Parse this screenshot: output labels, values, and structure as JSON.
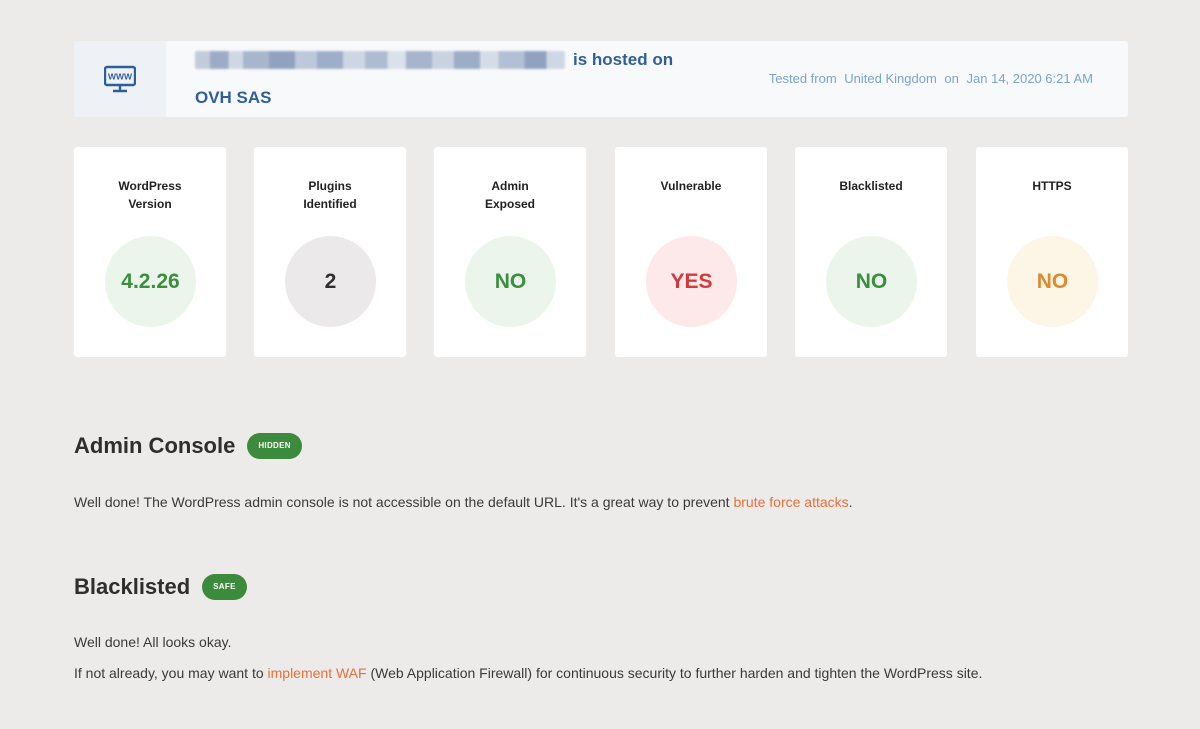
{
  "header": {
    "icon": "www-monitor-icon",
    "hosted_on_label": "is hosted on",
    "provider": "OVH SAS",
    "tested_from_label": "Tested from",
    "tested_country": "United Kingdom",
    "on_label": "on",
    "tested_date": "Jan 14, 2020 6:21 AM"
  },
  "stats": [
    {
      "label_line1": "WordPress",
      "label_line2": "Version",
      "value": "4.2.26",
      "status": "green"
    },
    {
      "label_line1": "Plugins",
      "label_line2": "Identified",
      "value": "2",
      "status": "grey"
    },
    {
      "label_line1": "Admin",
      "label_line2": "Exposed",
      "value": "NO",
      "status": "green"
    },
    {
      "label_line1": "Vulnerable",
      "label_line2": "",
      "value": "YES",
      "status": "red"
    },
    {
      "label_line1": "Blacklisted",
      "label_line2": "",
      "value": "NO",
      "status": "green"
    },
    {
      "label_line1": "HTTPS",
      "label_line2": "",
      "value": "NO",
      "status": "amber"
    }
  ],
  "colors": {
    "green": "#3a8f3d",
    "red": "#d03a3a",
    "amber": "#dc8a2c",
    "link": "#e8703a",
    "header_text": "#2f5f9b"
  },
  "admin_console": {
    "title": "Admin Console",
    "badge": "HIDDEN",
    "text_before": "Well done! The WordPress admin console is not accessible on the default URL. It's a great way to prevent ",
    "link_text": "brute force attacks",
    "text_after": "."
  },
  "blacklisted": {
    "title": "Blacklisted",
    "badge": "SAFE",
    "line1": "Well done! All looks okay.",
    "line2_before": "If not already, you may want to ",
    "link_text": "implement WAF",
    "line2_after": " (Web Application Firewall) for continuous security to further harden and tighten the WordPress site."
  }
}
